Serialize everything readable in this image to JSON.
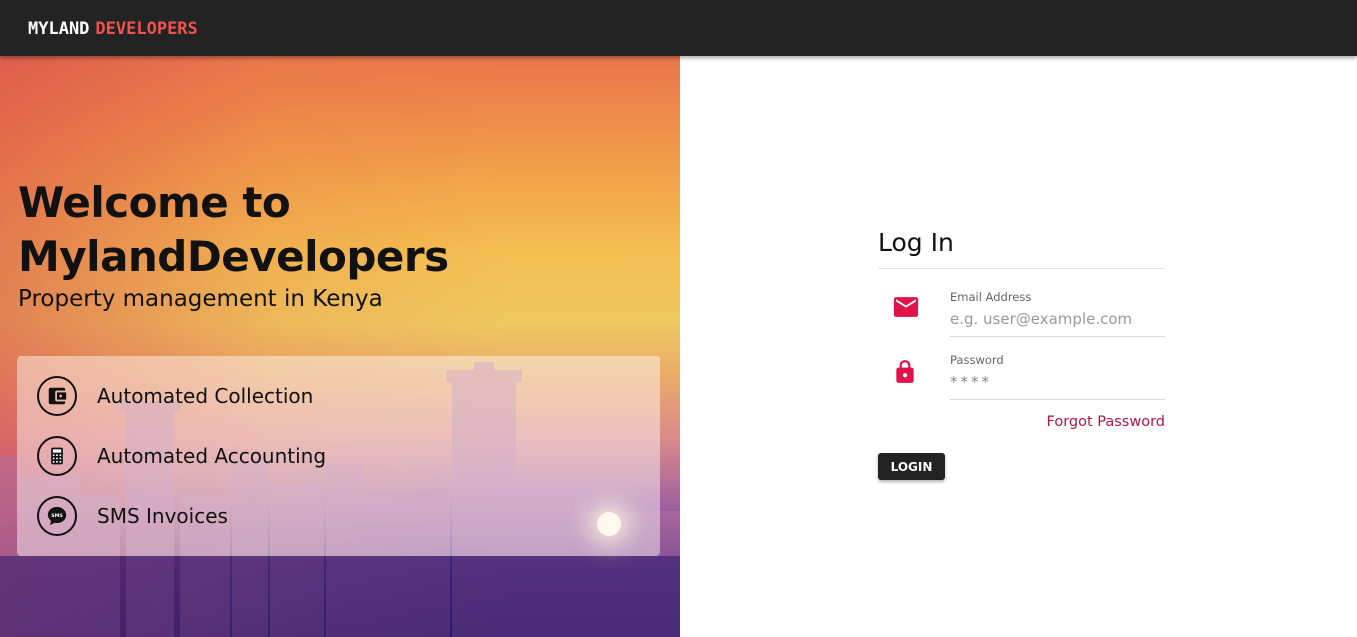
{
  "header": {
    "brand_primary": "MYLAND",
    "brand_secondary": "DEVELOPERS",
    "brand_accent_color": "#ef5350"
  },
  "hero": {
    "title": "Welcome to MylandDevelopers",
    "subtitle": "Property management in Kenya",
    "features": [
      {
        "label": "Automated Collection",
        "icon": "wallet-icon"
      },
      {
        "label": "Automated Accounting",
        "icon": "calculator-icon"
      },
      {
        "label": "SMS Invoices",
        "icon": "sms-icon"
      }
    ]
  },
  "login": {
    "title": "Log In",
    "email_label": "Email Address",
    "email_placeholder": "e.g. user@example.com",
    "email_value": "",
    "password_label": "Password",
    "password_value": "****",
    "forgot_label": "Forgot Password",
    "submit_label": "LOGIN",
    "icon_color": "#e0134a"
  }
}
